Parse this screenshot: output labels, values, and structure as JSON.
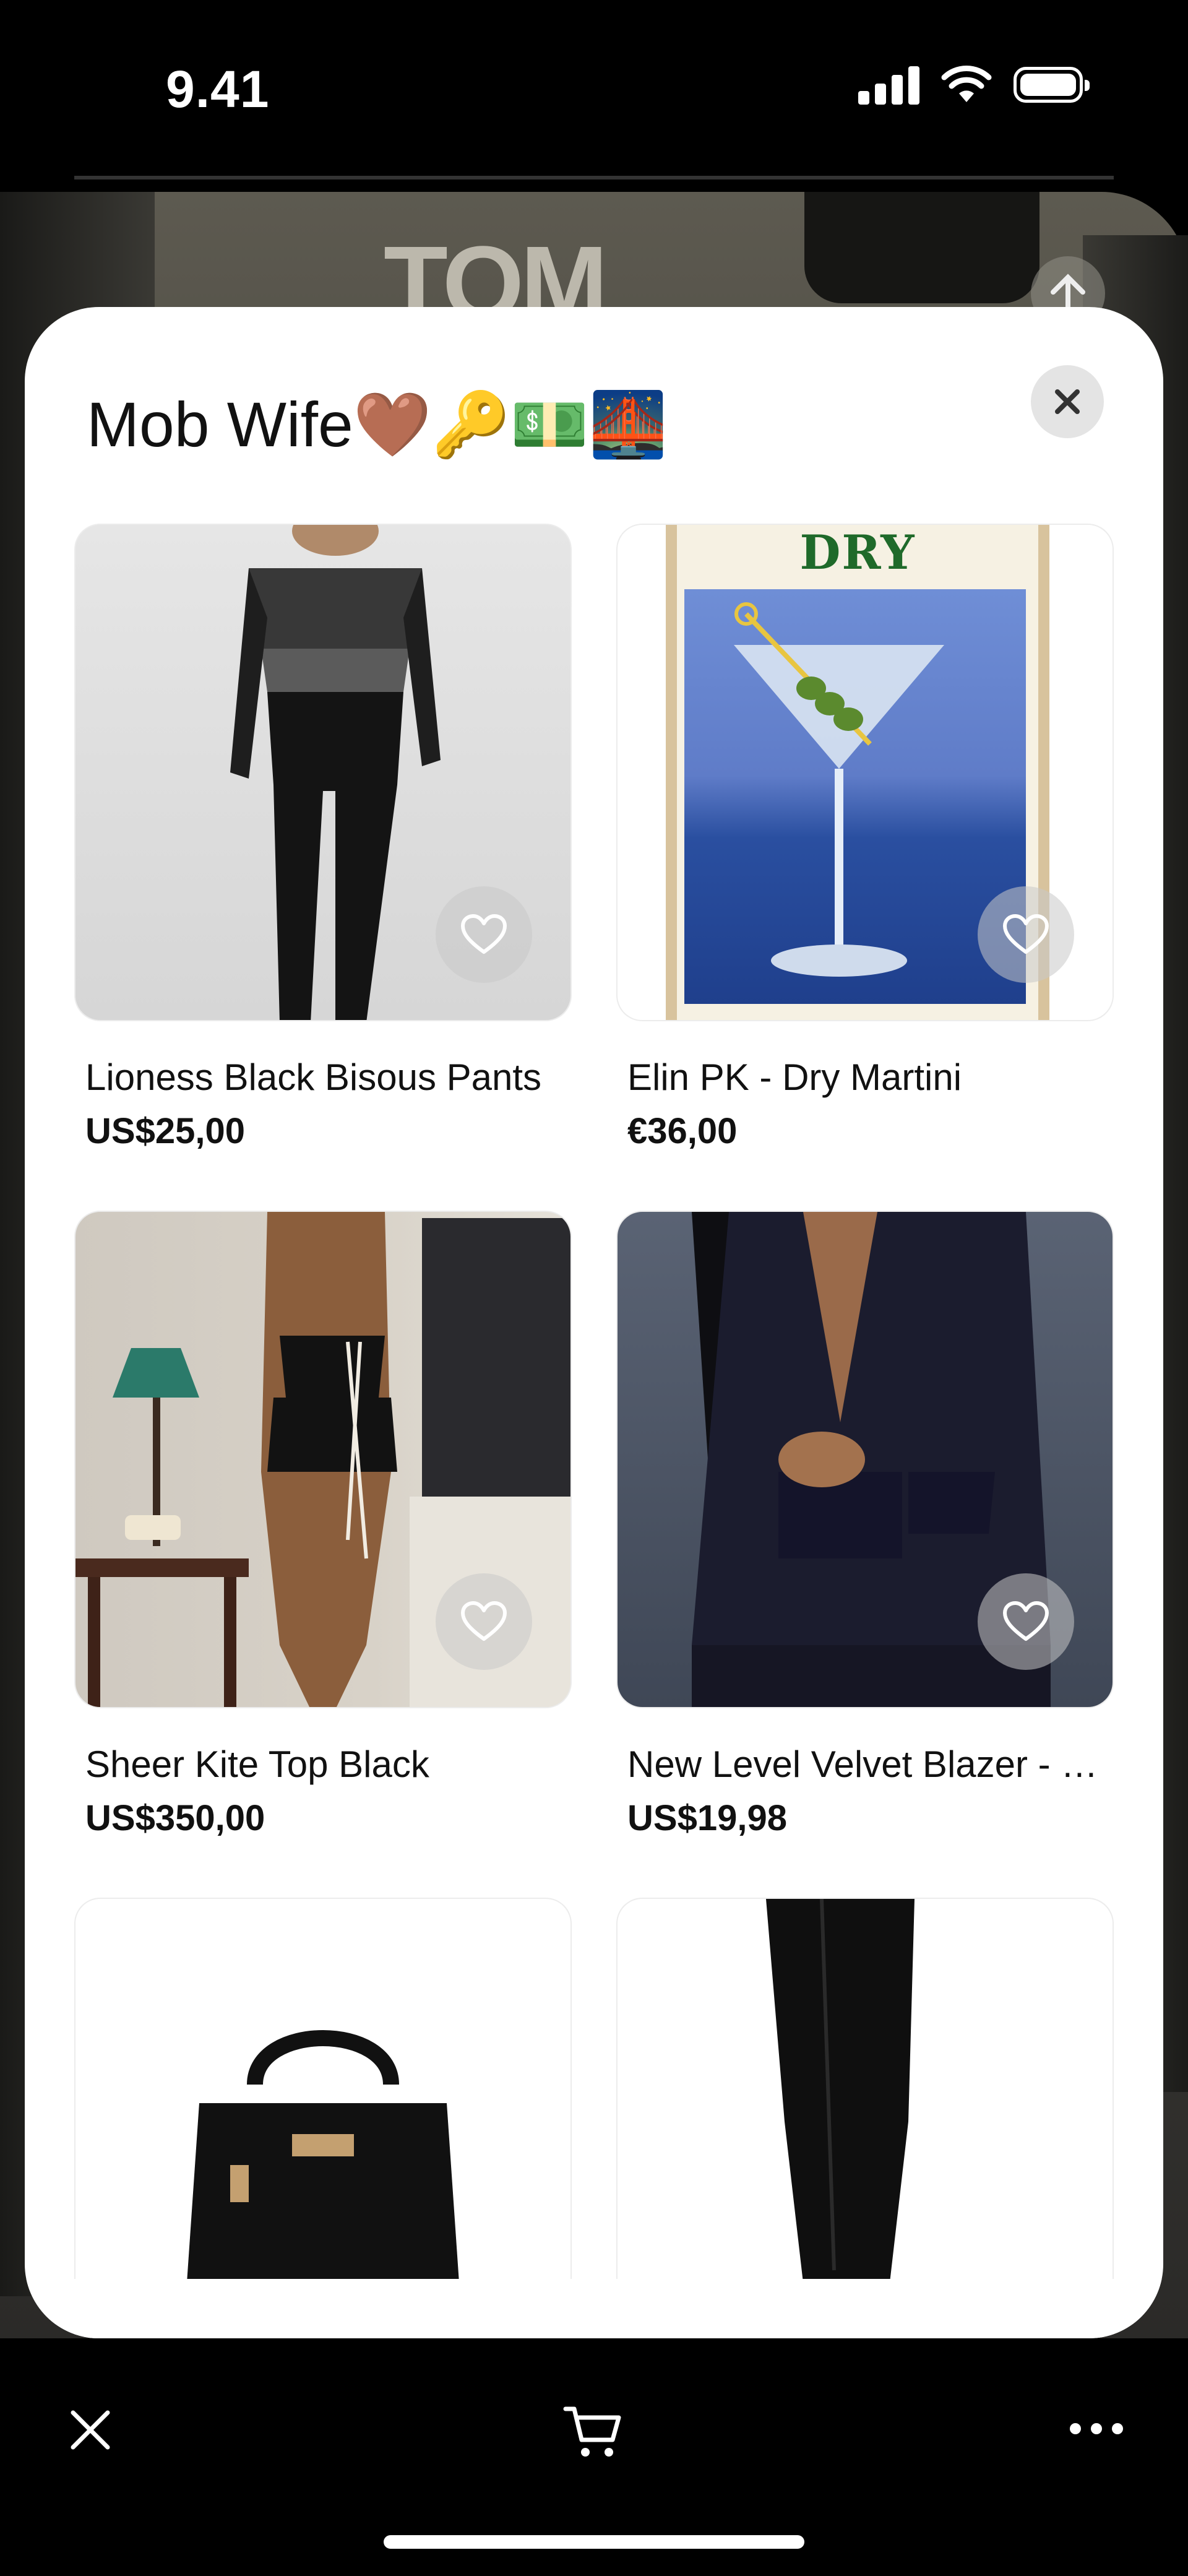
{
  "status_bar": {
    "time": "9.41"
  },
  "background": {
    "brand_text": "TOM"
  },
  "sheet": {
    "title": "Mob Wife🤎🔑💵🌉",
    "products": [
      {
        "name": "Lioness Black Bisous Pants",
        "price": "US$25,00"
      },
      {
        "name": "Elin PK - Dry Martini",
        "price": "€36,00",
        "poster_text": "DRY MARTINI"
      },
      {
        "name": "Sheer Kite Top Black",
        "price": "US$350,00"
      },
      {
        "name": "New Level Velvet Blazer - Black",
        "price": "US$19,98"
      }
    ]
  },
  "icons": {
    "close": "close-icon",
    "heart": "heart-icon",
    "cart": "cart-icon",
    "more": "more-icon"
  },
  "colors": {
    "sheet_background": "#ffffff",
    "heart_button": "#c8c8c8",
    "close_button": "#e4e4e4"
  }
}
